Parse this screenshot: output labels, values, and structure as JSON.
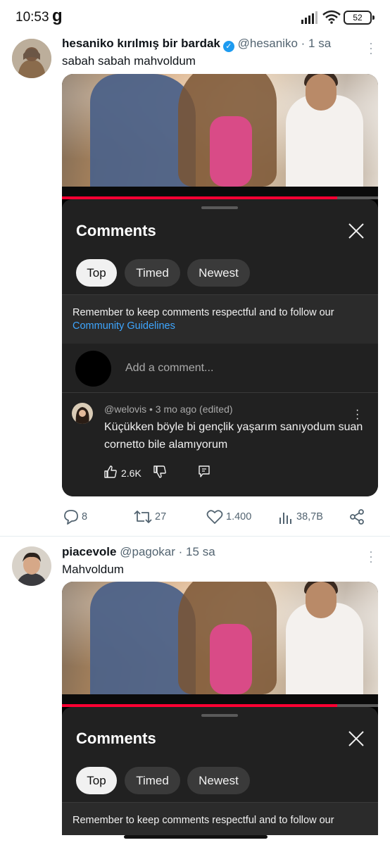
{
  "status_bar": {
    "time": "10:53",
    "app_glyph": "g",
    "battery": "52",
    "icons": [
      "signal-icon",
      "wifi-icon",
      "battery-icon"
    ]
  },
  "tweets": [
    {
      "author_name": "hesaniko kırılmış bir bardak",
      "verified": true,
      "handle": "@hesaniko",
      "time": "· 1 sa",
      "text": "sabah sabah mahvoldum",
      "video_progress_percent": 87,
      "comments_panel": {
        "title": "Comments",
        "chips": [
          "Top",
          "Timed",
          "Newest"
        ],
        "active_chip": "Top",
        "guidelines_text": "Remember to keep comments respectful and to follow our",
        "guidelines_link": "Community Guidelines",
        "add_comment_placeholder": "Add a comment...",
        "comment": {
          "meta": "@welovis • 3 mo ago (edited)",
          "text": "Küçükken böyle bi gençlik yaşarım sanıyodum suan cornetto bile alamıyorum",
          "likes": "2.6K"
        }
      },
      "actions": {
        "replies": "8",
        "retweets": "27",
        "likes": "1.400",
        "views": "38,7B"
      }
    },
    {
      "author_name": "piacevole",
      "handle": "@pagokar",
      "time": "· 15 sa",
      "text": "Mahvoldum",
      "video_progress_percent": 87,
      "comments_panel": {
        "title": "Comments",
        "chips": [
          "Top",
          "Timed",
          "Newest"
        ],
        "active_chip": "Top",
        "guidelines_text": "Remember to keep comments respectful and to follow our"
      }
    }
  ],
  "colors": {
    "verified_blue": "#1d9bf0",
    "yt_red": "#ff0033",
    "link_blue": "#3ea6ff",
    "panel_bg": "#212121"
  }
}
